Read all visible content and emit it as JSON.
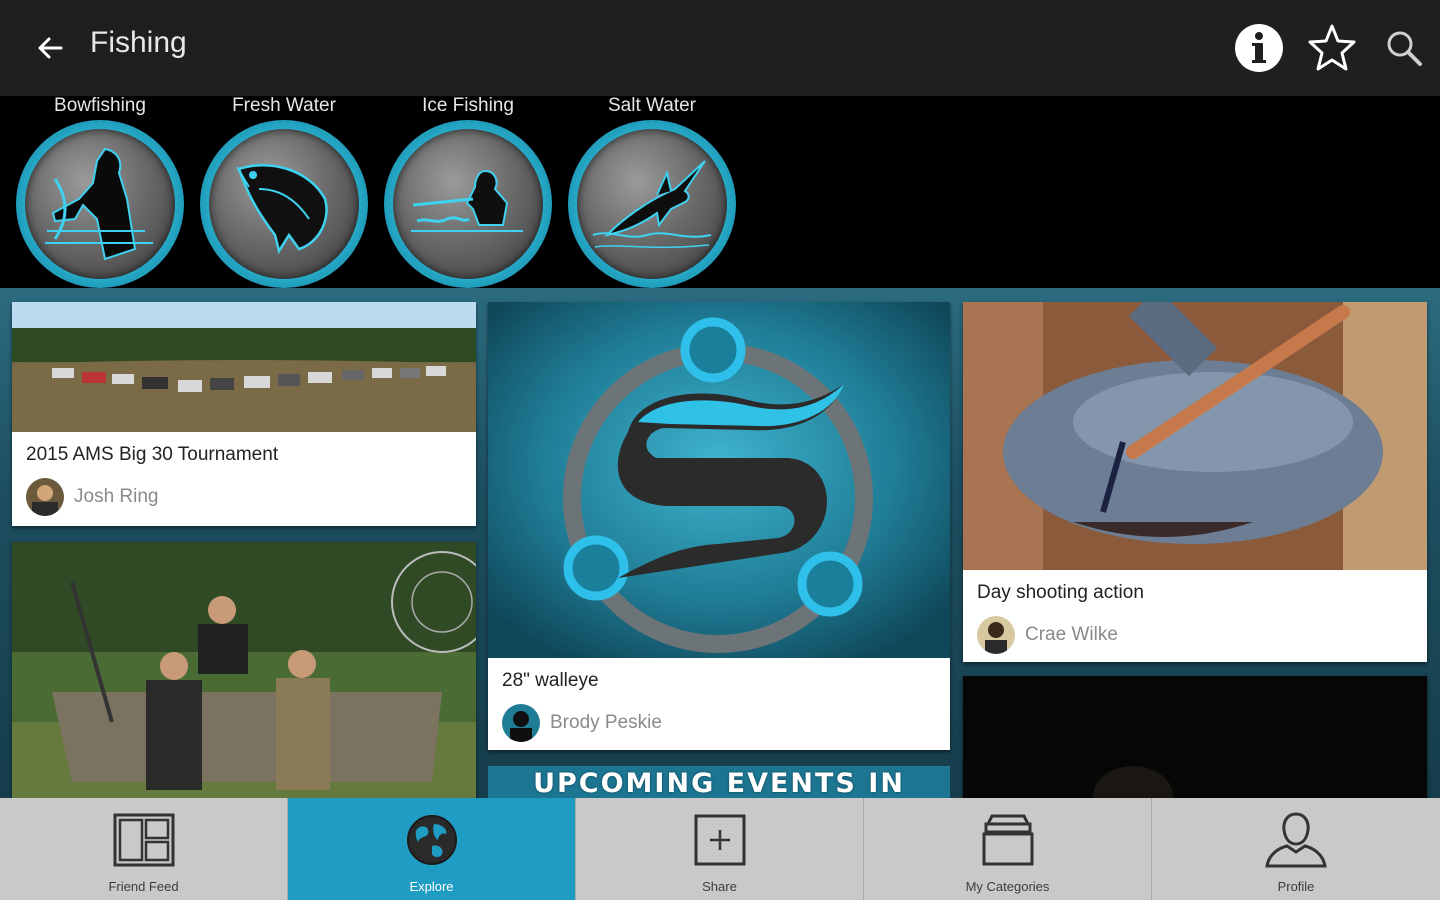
{
  "header": {
    "title": "Fishing"
  },
  "categories": [
    {
      "label": "Bowfishing",
      "icon": "bowfisher-icon"
    },
    {
      "label": "Fresh Water",
      "icon": "bass-icon"
    },
    {
      "label": "Ice Fishing",
      "icon": "ice-fisher-icon"
    },
    {
      "label": "Salt Water",
      "icon": "marlin-icon"
    }
  ],
  "cards": [
    {
      "title": "2015 AMS Big 30 Tournament",
      "author": "Josh Ring"
    },
    {
      "title": "28\" walleye",
      "author": "Brody Peskie"
    },
    {
      "title": "Day shooting action",
      "author": "Crae Wilke"
    }
  ],
  "banner": {
    "text": "UPCOMING EVENTS IN"
  },
  "nav": [
    {
      "label": "Friend Feed",
      "icon": "friend-feed-icon"
    },
    {
      "label": "Explore",
      "icon": "globe-icon"
    },
    {
      "label": "Share",
      "icon": "share-plus-icon"
    },
    {
      "label": "My Categories",
      "icon": "tray-stack-icon"
    },
    {
      "label": "Profile",
      "icon": "person-icon"
    }
  ],
  "colors": {
    "accent": "#1e9cc3",
    "topbar": "#1f1f1f",
    "navbar": "#c9c9c9"
  }
}
